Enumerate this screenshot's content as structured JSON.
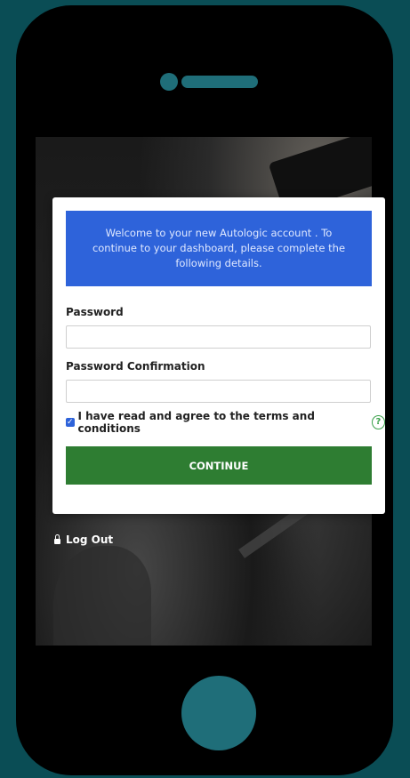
{
  "welcome": {
    "message": "Welcome to your new Autologic account . To continue to your dashboard, please complete the following details."
  },
  "form": {
    "password_label": "Password",
    "password_value": "",
    "password_confirmation_label": "Password Confirmation",
    "password_confirmation_value": "",
    "terms_label": "I have read and agree to the terms and conditions",
    "terms_checked": true,
    "help_icon_glyph": "?",
    "continue_label": "CONTINUE"
  },
  "footer": {
    "logout_label": "Log Out"
  },
  "colors": {
    "background": "#0a4d55",
    "banner": "#2e63da",
    "continue_button": "#2e7d32",
    "help_icon": "#3aa14a"
  }
}
